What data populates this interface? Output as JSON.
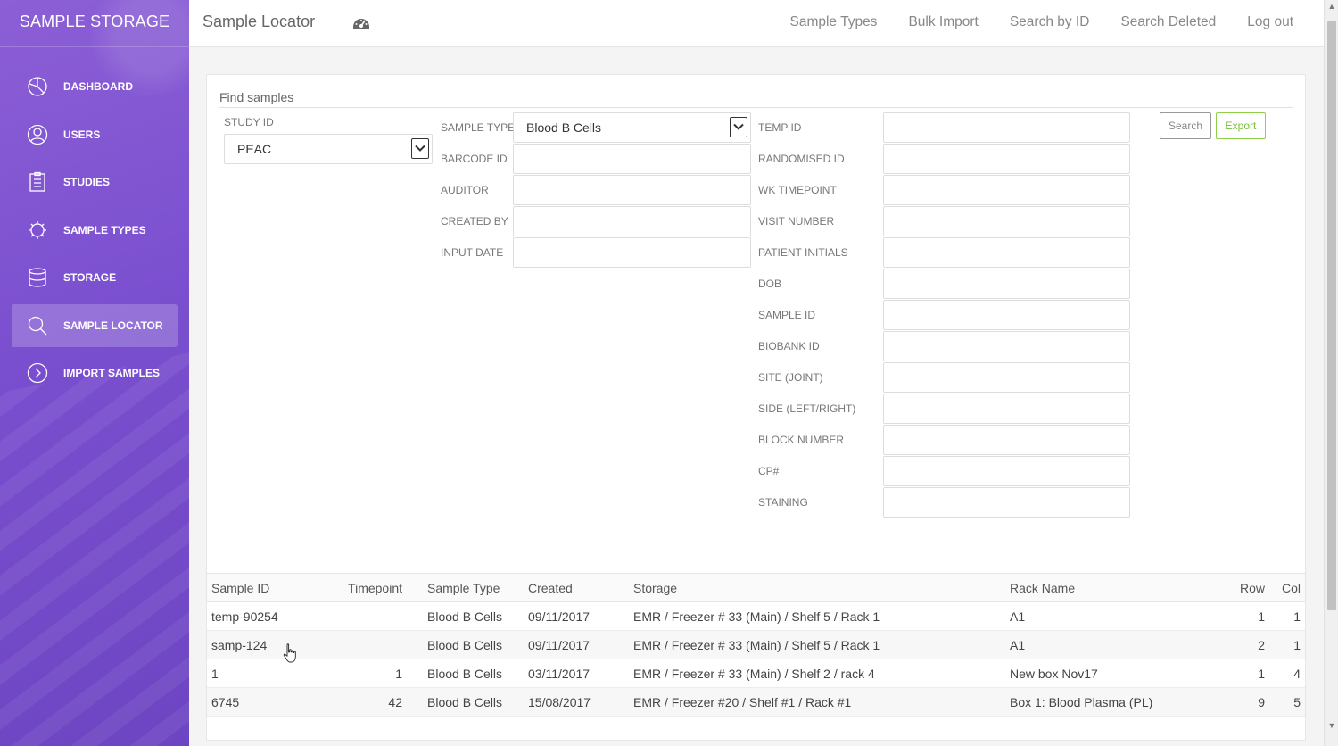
{
  "sidebar": {
    "brand": "SAMPLE STORAGE",
    "items": [
      {
        "label": "DASHBOARD",
        "icon": "pie-chart-icon"
      },
      {
        "label": "USERS",
        "icon": "user-icon"
      },
      {
        "label": "STUDIES",
        "icon": "clipboard-icon"
      },
      {
        "label": "SAMPLE TYPES",
        "icon": "gear-icon"
      },
      {
        "label": "STORAGE",
        "icon": "database-icon"
      },
      {
        "label": "SAMPLE LOCATOR",
        "icon": "search-icon",
        "active": true
      },
      {
        "label": "IMPORT SAMPLES",
        "icon": "chevron-right-circle-icon"
      }
    ]
  },
  "header": {
    "title": "Sample Locator",
    "nav": [
      "Sample Types",
      "Bulk Import",
      "Search by ID",
      "Search Deleted",
      "Log out"
    ]
  },
  "form": {
    "title": "Find samples",
    "study_id": {
      "label": "STUDY ID",
      "value": "PEAC"
    },
    "sample_type": {
      "label": "SAMPLE TYPE",
      "value": "Blood B Cells"
    },
    "middle_fields": [
      "BARCODE ID",
      "AUDITOR",
      "CREATED BY",
      "INPUT DATE"
    ],
    "right_fields": [
      "TEMP ID",
      "RANDOMISED ID",
      "WK TIMEPOINT",
      "VISIT NUMBER",
      "PATIENT INITIALS",
      "DOB",
      "SAMPLE ID",
      "BIOBANK ID",
      "SITE (JOINT)",
      "SIDE (LEFT/RIGHT)",
      "BLOCK NUMBER",
      "CP#",
      "STAINING"
    ],
    "search_label": "Search",
    "export_label": "Export"
  },
  "table": {
    "headers": [
      "Sample ID",
      "Timepoint",
      "Sample Type",
      "Created",
      "Storage",
      "Rack Name",
      "Row",
      "Col"
    ],
    "rows": [
      [
        "temp-90254",
        "",
        "Blood B Cells",
        "09/11/2017",
        "EMR / Freezer # 33 (Main) / Shelf 5 / Rack 1",
        "A1",
        "1",
        "1"
      ],
      [
        "samp-124",
        "",
        "Blood B Cells",
        "09/11/2017",
        "EMR / Freezer # 33 (Main) / Shelf 5 / Rack 1",
        "A1",
        "2",
        "1"
      ],
      [
        "1",
        "1",
        "Blood B Cells",
        "03/11/2017",
        "EMR / Freezer # 33 (Main) / Shelf 2 / rack 4",
        "New box Nov17",
        "1",
        "4"
      ],
      [
        "6745",
        "42",
        "Blood B Cells",
        "15/08/2017",
        "EMR / Freezer #20 / Shelf #1 / Rack #1",
        "Box 1: Blood Plasma (PL)",
        "9",
        "5"
      ]
    ]
  },
  "colors": {
    "sidebar": "#7a4fcf",
    "export": "#7cc03a"
  }
}
